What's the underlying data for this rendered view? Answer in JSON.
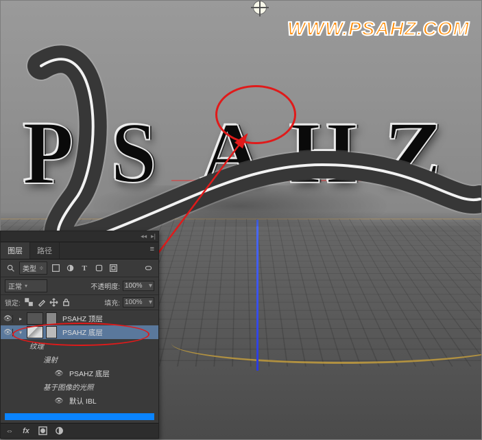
{
  "watermark_url": "WWW.PSAHZ.COM",
  "viewport": {
    "widget_icon": "sun-target-icon"
  },
  "text3d": {
    "letters": [
      "P",
      "S",
      "A",
      "H",
      "Z"
    ]
  },
  "panel": {
    "tabs": {
      "layers": "图层",
      "paths": "路径",
      "menu_icon": "≡"
    },
    "filter": {
      "kind_label": "类型",
      "kind_chevron": "≑",
      "icons": [
        "img-icon",
        "adj-icon",
        "type-icon",
        "shape-icon",
        "fx-icon"
      ]
    },
    "blend": {
      "mode": "正常",
      "opacity_label": "不透明度:",
      "opacity_value": "100%"
    },
    "lock": {
      "label": "锁定:",
      "icons": [
        "transparency-lock",
        "brush-lock",
        "move-lock",
        "lock-all"
      ],
      "fill_label": "填充:",
      "fill_value": "100%"
    },
    "tree": {
      "item1": {
        "name": "PSAHZ 顶层"
      },
      "item2": {
        "name": "PSAHZ 底层"
      },
      "sub_texture": "纹理",
      "sub_diffuse": "漫射",
      "sub_diffuse_child": "PSAHZ 底层",
      "sub_ibl_group": "基于图像的光照",
      "sub_ibl_default": "默认 IBL"
    },
    "footer_icons": [
      "link-icon",
      "fx-icon",
      "mask-icon",
      "folder-icon"
    ]
  },
  "annotations": {
    "circle": "highlight-letter-A",
    "arrow": "arrow-from-layer-to-A",
    "ellipse": "highlight-selected-layer"
  },
  "colors": {
    "accent_red": "#e01a1a",
    "url_orange": "#ff8a00",
    "select_blue": "#5a789c"
  }
}
